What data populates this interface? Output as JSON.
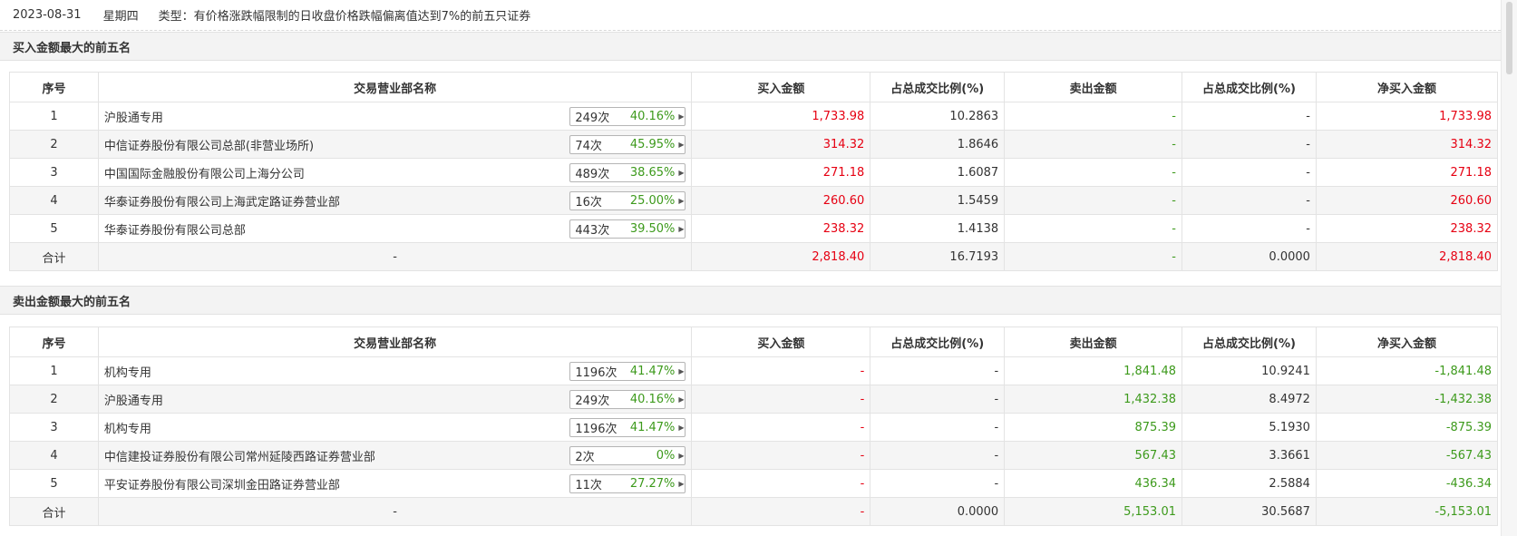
{
  "header": {
    "date": "2023-08-31",
    "weekday": "星期四",
    "type_label": "类型：",
    "type_value": "有价格涨跌幅限制的日收盘价格跌幅偏离值达到7%的前五只证券"
  },
  "columns": [
    "序号",
    "交易营业部名称",
    "买入金额",
    "占总成交比例(%)",
    "卖出金额",
    "占总成交比例(%)",
    "净买入金额"
  ],
  "buy_section": {
    "title": "买入金额最大的前五名",
    "rows": [
      {
        "no": "1",
        "name": "沪股通专用",
        "count": "249次",
        "pct": "40.16%",
        "buy": "1,733.98",
        "buy_ratio": "10.2863",
        "sell": "-",
        "sell_ratio": "-",
        "net": "1,733.98"
      },
      {
        "no": "2",
        "name": "中信证券股份有限公司总部(非营业场所)",
        "count": "74次",
        "pct": "45.95%",
        "buy": "314.32",
        "buy_ratio": "1.8646",
        "sell": "-",
        "sell_ratio": "-",
        "net": "314.32"
      },
      {
        "no": "3",
        "name": "中国国际金融股份有限公司上海分公司",
        "count": "489次",
        "pct": "38.65%",
        "buy": "271.18",
        "buy_ratio": "1.6087",
        "sell": "-",
        "sell_ratio": "-",
        "net": "271.18"
      },
      {
        "no": "4",
        "name": "华泰证券股份有限公司上海武定路证券营业部",
        "count": "16次",
        "pct": "25.00%",
        "buy": "260.60",
        "buy_ratio": "1.5459",
        "sell": "-",
        "sell_ratio": "-",
        "net": "260.60"
      },
      {
        "no": "5",
        "name": "华泰证券股份有限公司总部",
        "count": "443次",
        "pct": "39.50%",
        "buy": "238.32",
        "buy_ratio": "1.4138",
        "sell": "-",
        "sell_ratio": "-",
        "net": "238.32"
      }
    ],
    "total": {
      "label": "合计",
      "name": "-",
      "buy": "2,818.40",
      "buy_ratio": "16.7193",
      "sell": "-",
      "sell_ratio": "0.0000",
      "net": "2,818.40"
    }
  },
  "sell_section": {
    "title": "卖出金额最大的前五名",
    "rows": [
      {
        "no": "1",
        "name": "机构专用",
        "count": "1196次",
        "pct": "41.47%",
        "buy": "-",
        "buy_ratio": "-",
        "sell": "1,841.48",
        "sell_ratio": "10.9241",
        "net": "-1,841.48"
      },
      {
        "no": "2",
        "name": "沪股通专用",
        "count": "249次",
        "pct": "40.16%",
        "buy": "-",
        "buy_ratio": "-",
        "sell": "1,432.38",
        "sell_ratio": "8.4972",
        "net": "-1,432.38"
      },
      {
        "no": "3",
        "name": "机构专用",
        "count": "1196次",
        "pct": "41.47%",
        "buy": "-",
        "buy_ratio": "-",
        "sell": "875.39",
        "sell_ratio": "5.1930",
        "net": "-875.39"
      },
      {
        "no": "4",
        "name": "中信建投证券股份有限公司常州延陵西路证券营业部",
        "count": "2次",
        "pct": "0%",
        "buy": "-",
        "buy_ratio": "-",
        "sell": "567.43",
        "sell_ratio": "3.3661",
        "net": "-567.43"
      },
      {
        "no": "5",
        "name": "平安证券股份有限公司深圳金田路证券营业部",
        "count": "11次",
        "pct": "27.27%",
        "buy": "-",
        "buy_ratio": "-",
        "sell": "436.34",
        "sell_ratio": "2.5884",
        "net": "-436.34"
      }
    ],
    "total": {
      "label": "合计",
      "name": "-",
      "buy": "-",
      "buy_ratio": "0.0000",
      "sell": "5,153.01",
      "sell_ratio": "30.5687",
      "net": "-5,153.01"
    }
  },
  "colors": {
    "up": "#e60012",
    "down": "#3d9a1c",
    "row_alt": "#f5f5f5",
    "section_bg": "#f3f3f3"
  },
  "icons": {
    "stat_arrow": "triangle-right-icon"
  }
}
